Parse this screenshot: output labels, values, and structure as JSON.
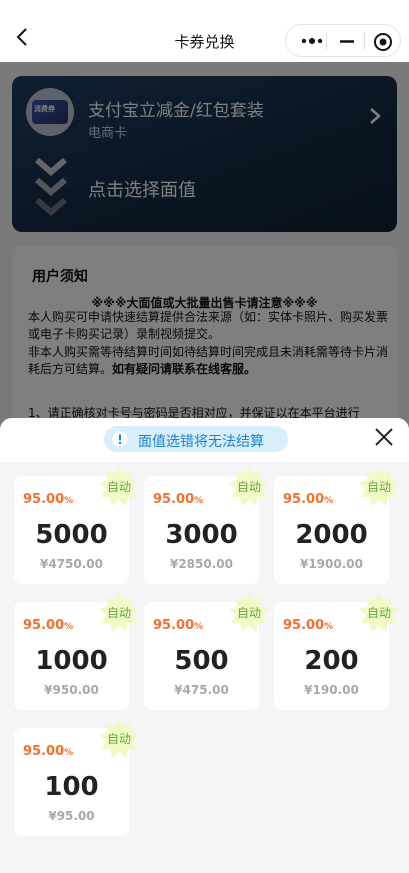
{
  "nav": {
    "title": "卡券兑换"
  },
  "card": {
    "title": "支付宝立减金/红包套装",
    "subtitle": "电商卡",
    "thumb_text": "消费券",
    "select_label": "点击选择面值"
  },
  "notice": {
    "heading": "用户须知",
    "warning": "※※※大面值或大批量出售卡请注意※※※",
    "para1": "本人购买可申请快速结算提供合法来源（如：实体卡照片、购买发票或电子卡购买记录）录制视频提交。",
    "para2_text": "非本人购买需等待结算时间如待结算时间完成且未消耗需等待卡片消耗后方可结算。",
    "para2_bold": "如有疑问请联系在线客服。",
    "rule1": "1、请正确核对卡号与密码是否相对应，并保证以在本平台进行"
  },
  "sheet": {
    "tip": "面值选错将无法结算",
    "tiles": [
      {
        "rate": "95.00",
        "pct": "%",
        "amount": "5000",
        "price": "¥4750.00",
        "badge": "自动"
      },
      {
        "rate": "95.00",
        "pct": "%",
        "amount": "3000",
        "price": "¥2850.00",
        "badge": "自动"
      },
      {
        "rate": "95.00",
        "pct": "%",
        "amount": "2000",
        "price": "¥1900.00",
        "badge": "自动"
      },
      {
        "rate": "95.00",
        "pct": "%",
        "amount": "1000",
        "price": "¥950.00",
        "badge": "自动"
      },
      {
        "rate": "95.00",
        "pct": "%",
        "amount": "500",
        "price": "¥475.00",
        "badge": "自动"
      },
      {
        "rate": "95.00",
        "pct": "%",
        "amount": "200",
        "price": "¥190.00",
        "badge": "自动"
      },
      {
        "rate": "95.00",
        "pct": "%",
        "amount": "100",
        "price": "¥95.00",
        "badge": "自动"
      }
    ]
  },
  "colors": {
    "rate": "#f56e2b",
    "badge_bg": "#f1f9c6",
    "tip_bg": "#d7effb",
    "tip_text": "#1b83d3",
    "hero": "#162c47"
  },
  "icons": [
    "back-arrow-icon",
    "more-dots-icon",
    "minimize-icon",
    "target-close-icon",
    "chevron-right-icon",
    "chevron-down-stack-icon",
    "info-icon",
    "close-icon",
    "starburst-badge-icon"
  ]
}
